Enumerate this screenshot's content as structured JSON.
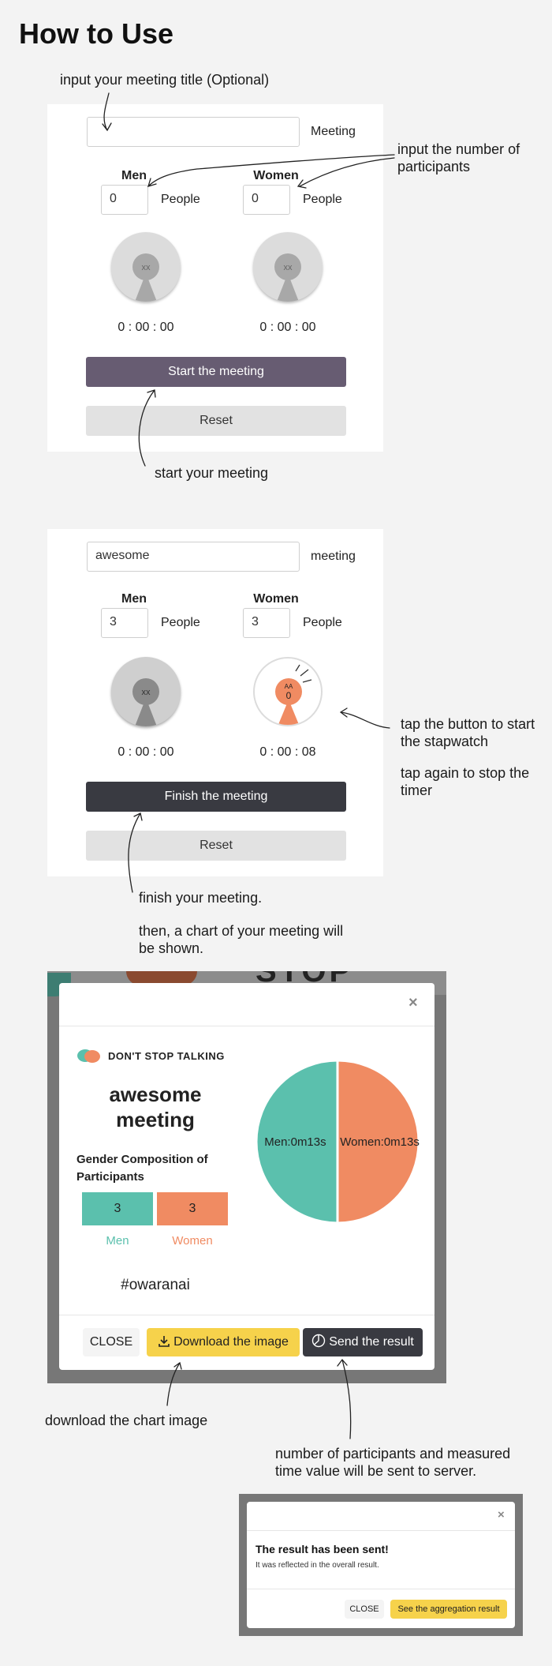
{
  "page": {
    "title": "How to Use"
  },
  "notes": {
    "title_hint": "input your meeting title (Optional)",
    "participants_hint_1": "input the number of",
    "participants_hint_2": "participants",
    "start_hint": "start your meeting",
    "tap_hint_1": "tap the button to start",
    "tap_hint_2": "the stapwatch",
    "tap_hint_3": "tap again to stop the",
    "tap_hint_4": "timer",
    "finish_hint_1": "finish your meeting.",
    "finish_hint_2": "then, a chart of your meeting will",
    "finish_hint_3": "be shown.",
    "download_hint": "download the chart image",
    "send_hint_1": "number of participants and measured",
    "send_hint_2": "time value will be sent to server."
  },
  "setup": {
    "title_value": "",
    "title_suffix": "Meeting",
    "men_label": "Men",
    "women_label": "Women",
    "men_count": "0",
    "women_count": "0",
    "people_label": "People",
    "men_avatar_text": "xx",
    "women_avatar_text": "xx",
    "men_timer": "0 : 00 : 00",
    "women_timer": "0 : 00 : 00",
    "start_button": "Start the meeting",
    "reset_button": "Reset"
  },
  "running": {
    "title_value": "awesome",
    "title_suffix": "meeting",
    "men_label": "Men",
    "women_label": "Women",
    "men_count": "3",
    "women_count": "3",
    "people_label": "People",
    "men_avatar_text": "xx",
    "women_avatar_text_top": "AA",
    "women_avatar_text": "0",
    "men_timer": "0 : 00 : 00",
    "women_timer": "0 : 00 : 08",
    "finish_button": "Finish the meeting",
    "reset_button": "Reset"
  },
  "result_modal": {
    "background_text": "STOP",
    "brand": "DON'T STOP TALKING",
    "meeting_title_1": "awesome",
    "meeting_title_2": "meeting",
    "composition_title_1": "Gender Composition of",
    "composition_title_2": "Participants",
    "men_count": "3",
    "women_count": "3",
    "men_label": "Men",
    "women_label": "Women",
    "hashtag": "#owaranai",
    "close_button": "CLOSE",
    "download_button": "Download the image",
    "send_button": "Send the result",
    "colors": {
      "men": "#5bc0ad",
      "women": "#f08b62",
      "download": "#f6d24b",
      "send": "#393a41"
    }
  },
  "chart_data": {
    "type": "pie",
    "categories": [
      "Men",
      "Women"
    ],
    "labels": [
      "Men:0m13s",
      "Women:0m13s"
    ],
    "values": [
      13,
      13
    ],
    "colors": [
      "#5bc0ad",
      "#f08b62"
    ]
  },
  "sent_modal": {
    "title": "The result has been sent!",
    "body": "It was reflected in the overall result.",
    "close_button": "CLOSE",
    "aggregation_button": "See the aggregation result"
  }
}
